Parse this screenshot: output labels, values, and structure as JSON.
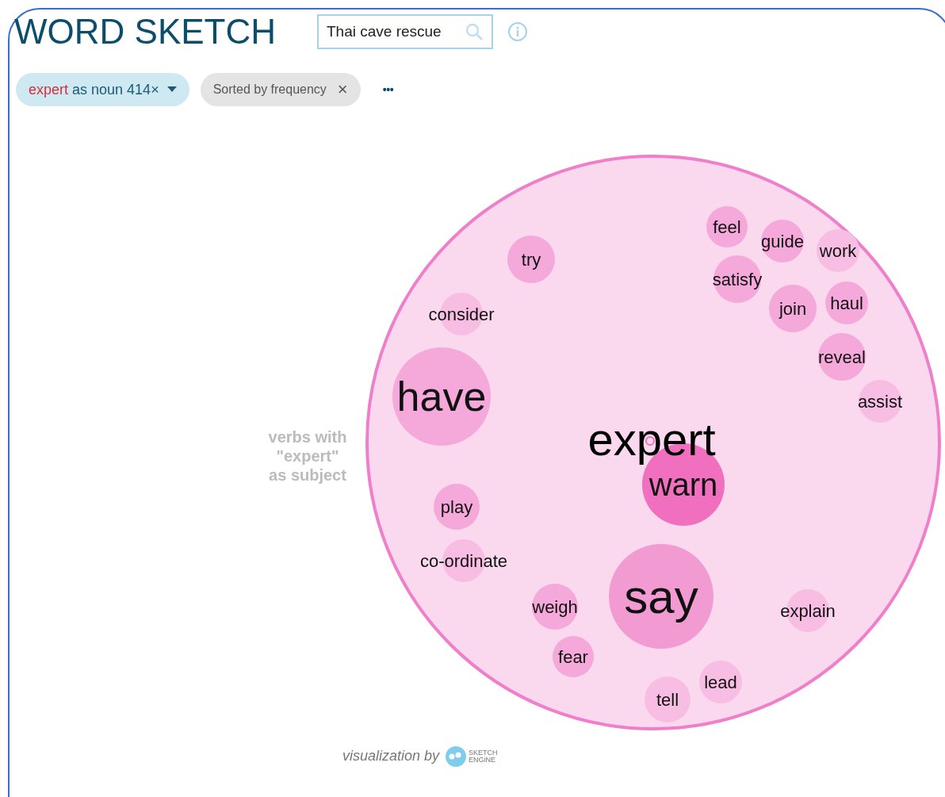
{
  "title": "WORD SKETCH",
  "search": {
    "value": "Thai cave rescue"
  },
  "filters": {
    "lemma": {
      "word": "expert",
      "rest": "as noun 414×"
    },
    "sort": {
      "label": "Sorted by frequency",
      "close": "×"
    },
    "more": "•••"
  },
  "chart": {
    "center": "expert",
    "relation": [
      "verbs with",
      "\"expert\"",
      "as subject"
    ],
    "bubbles": [
      {
        "label": "feel",
        "color": "#f5a8da"
      },
      {
        "label": "guide",
        "color": "#f5a8da"
      },
      {
        "label": "work",
        "color": "#f8bde3"
      },
      {
        "label": "try",
        "color": "#f5a8da"
      },
      {
        "label": "satisfy",
        "color": "#f5a8da"
      },
      {
        "label": "haul",
        "color": "#f5a8da"
      },
      {
        "label": "consider",
        "color": "#f8bde3"
      },
      {
        "label": "join",
        "color": "#f5a8da"
      },
      {
        "label": "reveal",
        "color": "#f5a8da"
      },
      {
        "label": "have",
        "color": "#f5a8da"
      },
      {
        "label": "assist",
        "color": "#f8bde3"
      },
      {
        "label": "warn",
        "color": "#f06fbf"
      },
      {
        "label": "play",
        "color": "#f5a8da"
      },
      {
        "label": "co-ordinate",
        "color": "#f8bde3"
      },
      {
        "label": "weigh",
        "color": "#f5a8da"
      },
      {
        "label": "say",
        "color": "#f29ad2"
      },
      {
        "label": "explain",
        "color": "#f8bde3"
      },
      {
        "label": "fear",
        "color": "#f5a8da"
      },
      {
        "label": "lead",
        "color": "#f8bde3"
      },
      {
        "label": "tell",
        "color": "#f8bde3"
      }
    ]
  },
  "footer": {
    "text": "visualization by",
    "logo": [
      "SKETCH",
      "ENGiNE"
    ]
  }
}
